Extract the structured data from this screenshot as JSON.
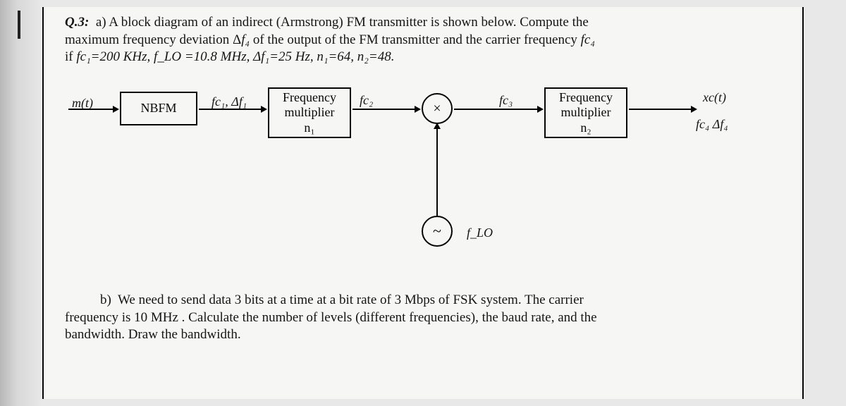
{
  "question_a": {
    "prefix": "Q.3:",
    "label": "a)",
    "line1": "A block diagram of an indirect (Armstrong) FM transmitter is shown below. Compute the",
    "line2_pre": "maximum frequency deviation Δ",
    "line2_sym1": "f₄",
    "line2_mid": " of the output of the FM transmitter and the carrier frequency ",
    "line2_sym2": "fc₄",
    "line3_pre": "if ",
    "line3_vals": "fc₁=200 KHz, f_LO =10.8 MHz, Δf₁=25 Hz, n₁=64, n₂=48."
  },
  "diagram": {
    "input": "m(t)",
    "nbfm": "NBFM",
    "sig1": "fc₁, Δf₁",
    "mult1_top": "Frequency",
    "mult1_mid": "multiplier",
    "mult1_bot": "n₁",
    "sig2": "fc₂",
    "mixer": "×",
    "sig3": "fc₃",
    "mult2_top": "Frequency",
    "mult2_mid": "multiplier",
    "mult2_bot": "n₂",
    "out_top": "xc(t)",
    "out_bot": "fc₄ Δf₄",
    "osc": "~",
    "flo": "f_LO"
  },
  "question_b": {
    "label": "b)",
    "line1": "We need to send data 3 bits at a time at a bit rate of 3 Mbps of FSK system. The carrier",
    "line2": "frequency is 10 MHz . Calculate the number of levels (different frequencies), the baud rate, and the",
    "line3": "bandwidth. Draw the bandwidth."
  }
}
